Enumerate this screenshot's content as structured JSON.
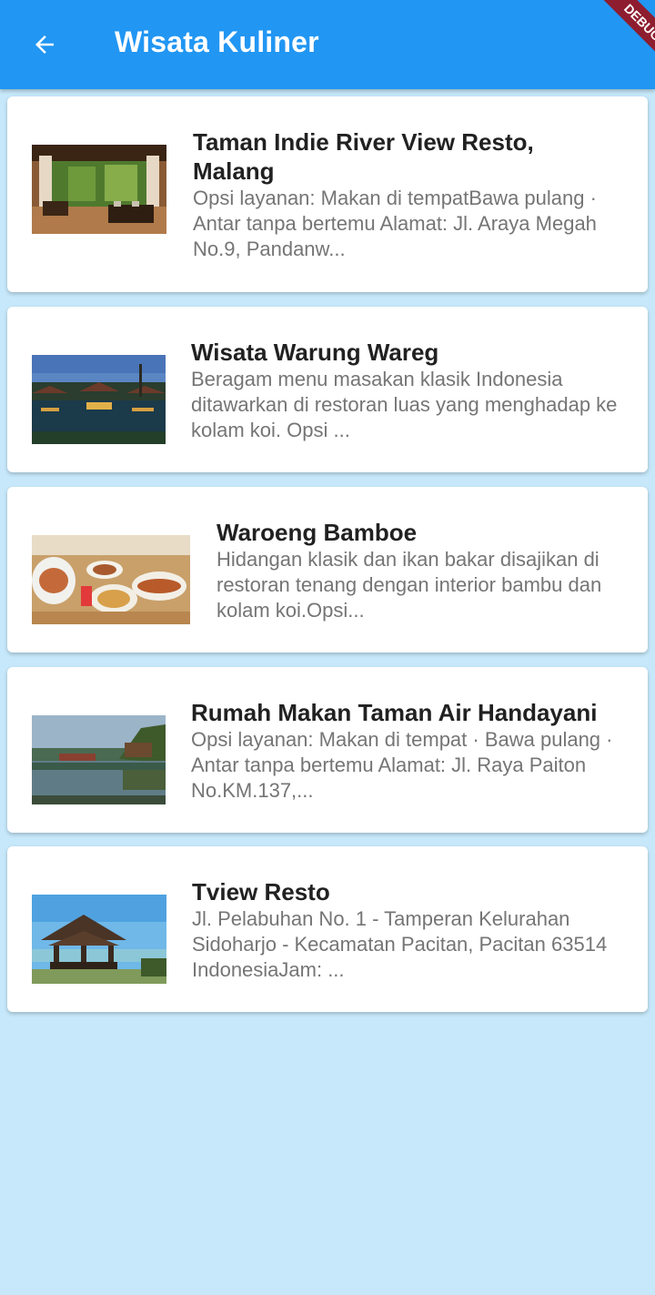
{
  "appbar": {
    "title": "Wisata Kuliner",
    "debug_label": "DEBUG",
    "color": "#2196f3"
  },
  "items": [
    {
      "title": "Taman Indie River View Resto, Malang",
      "description": "Opsi layanan: Makan di tempatBawa pulang · Antar tanpa bertemu Alamat: Jl. Araya Megah No.9, Pandanw..."
    },
    {
      "title": "Wisata Warung Wareg",
      "description": "Beragam menu masakan klasik Indonesia ditawarkan di restoran luas yang menghadap ke kolam koi. Opsi ..."
    },
    {
      "title": "Waroeng Bamboe",
      "description": "Hidangan klasik dan ikan bakar disajikan di restoran tenang dengan interior bambu dan kolam koi.Opsi..."
    },
    {
      "title": "Rumah Makan Taman Air Handayani",
      "description": "Opsi layanan: Makan di tempat · Bawa pulang · Antar tanpa bertemu Alamat: Jl. Raya Paiton No.KM.137,..."
    },
    {
      "title": "Tview Resto",
      "description": "Jl. Pelabuhan No. 1 - Tamperan Kelurahan Sidoharjo - Kecamatan Pacitan, Pacitan 63514 IndonesiaJam: ..."
    }
  ]
}
